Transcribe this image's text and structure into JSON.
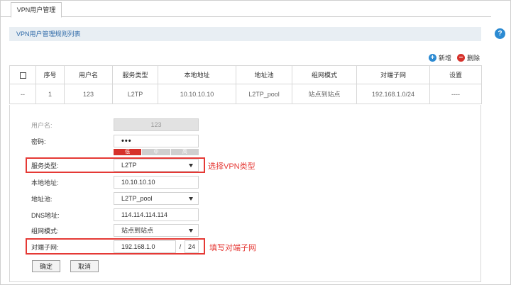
{
  "tab": {
    "label": "VPN用户管理"
  },
  "help": {
    "glyph": "?"
  },
  "section": {
    "title": "VPN用户管理规则列表"
  },
  "actions": {
    "add_label": "新增",
    "add_glyph": "+",
    "delete_label": "删除",
    "delete_glyph": "−"
  },
  "table": {
    "headers": [
      "",
      "序号",
      "用户名",
      "服务类型",
      "本地地址",
      "地址池",
      "组网模式",
      "对端子网",
      "设置"
    ],
    "rows": [
      [
        "--",
        "1",
        "123",
        "L2TP",
        "10.10.10.10",
        "L2TP_pool",
        "站点到站点",
        "192.168.1.0/24",
        "----"
      ]
    ]
  },
  "form": {
    "username": {
      "label": "用户名:",
      "value": "123"
    },
    "password": {
      "label": "密码:",
      "value": "•••"
    },
    "strength": {
      "low": "低",
      "mid": "中",
      "high": "高"
    },
    "service_type": {
      "label": "服务类型:",
      "value": "L2TP"
    },
    "local_address": {
      "label": "本地地址:",
      "value": "10.10.10.10"
    },
    "address_pool": {
      "label": "地址池:",
      "value": "L2TP_pool"
    },
    "dns": {
      "label": "DNS地址:",
      "value": "114.114.114.114"
    },
    "network_mode": {
      "label": "组网模式:",
      "value": "站点到站点"
    },
    "remote_subnet": {
      "label": "对端子网:",
      "ip": "192.168.1.0",
      "slash": "/",
      "mask": "24"
    },
    "confirm_label": "确定",
    "cancel_label": "取消"
  },
  "annotations": {
    "vpn_type": "选择VPN类型",
    "subnet": "填写对端子网"
  },
  "colors": {
    "accent_blue": "#2b8ad2",
    "danger_red": "#d6312b",
    "annotation_red": "#e53935",
    "header_bg": "#e8eef3"
  }
}
